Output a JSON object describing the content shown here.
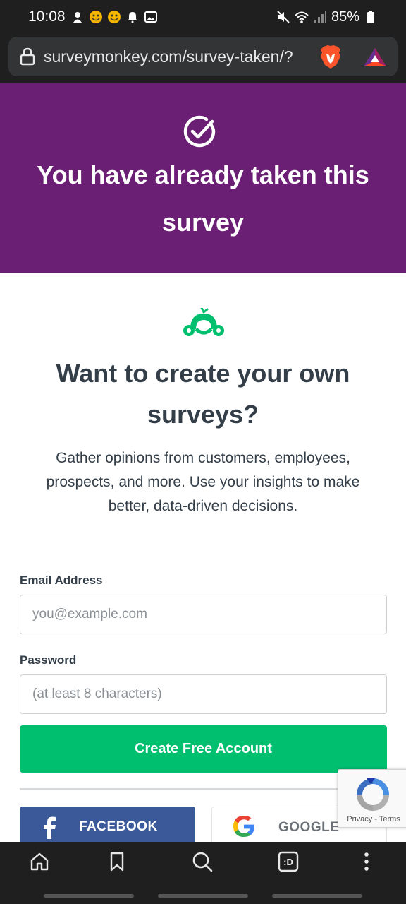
{
  "status_bar": {
    "time": "10:08",
    "battery": "85%"
  },
  "browser": {
    "url": "surveymonkey.com/survey-taken/?"
  },
  "banner": {
    "title": "You have already taken this survey",
    "background_color": "#6b1f74"
  },
  "promo": {
    "title": "Want to create your own surveys?",
    "description": "Gather opinions from customers, employees, prospects, and more. Use your insights to make better, data-driven decisions.",
    "logo_color": "#00bf6f"
  },
  "form": {
    "email_label": "Email Address",
    "email_placeholder": "you@example.com",
    "password_label": "Password",
    "password_placeholder": "(at least 8 characters)",
    "submit_label": "Create Free Account",
    "submit_color": "#00bf6f"
  },
  "social": {
    "facebook_label": "FACEBOOK",
    "google_label": "GOOGLE"
  },
  "recaptcha": {
    "links": "Privacy - Terms"
  },
  "bottom_nav": {
    "tabs_badge": ":D",
    "icons": [
      "home-icon",
      "bookmark-icon",
      "search-icon",
      "tabs-icon",
      "menu-icon"
    ]
  }
}
